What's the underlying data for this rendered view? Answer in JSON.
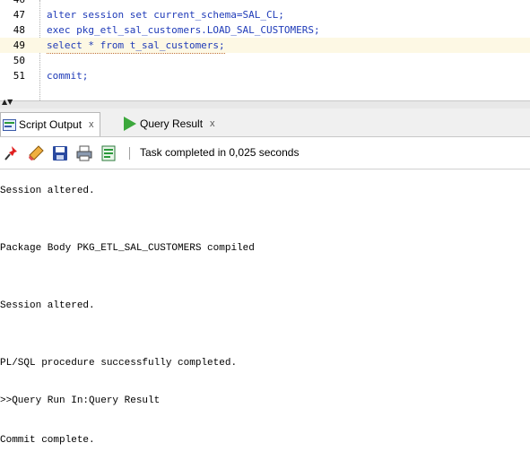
{
  "editor": {
    "lines": [
      {
        "num": "46",
        "text": ""
      },
      {
        "num": "47",
        "text": "alter session set current_schema=SAL_CL;"
      },
      {
        "num": "48",
        "text": "exec pkg_etl_sal_customers.LOAD_SAL_CUSTOMERS;"
      },
      {
        "num": "49",
        "text": "select * from t_sal_customers;"
      },
      {
        "num": "50",
        "text": ""
      },
      {
        "num": "51",
        "text": "commit;"
      }
    ]
  },
  "tabs": [
    {
      "label": "Script Output",
      "close": "x",
      "icon": "script-output-icon"
    },
    {
      "label": "Query Result",
      "close": "x",
      "icon": "run-green-icon"
    }
  ],
  "toolbar": {
    "icons": [
      "pin-icon",
      "eraser-icon",
      "save-icon",
      "print-icon",
      "document-icon"
    ],
    "status": "Task completed in 0,025 seconds"
  },
  "output": {
    "lines": [
      "Session altered.",
      "Package Body PKG_ETL_SAL_CUSTOMERS compiled",
      "Session altered.",
      "PL/SQL procedure successfully completed.",
      ">>Query Run In:Query Result",
      "Commit complete."
    ]
  },
  "colors": {
    "keyword": "#1f3bb8",
    "current_line": "#fdf8e4",
    "tab_bar": "#f0f0f0"
  }
}
